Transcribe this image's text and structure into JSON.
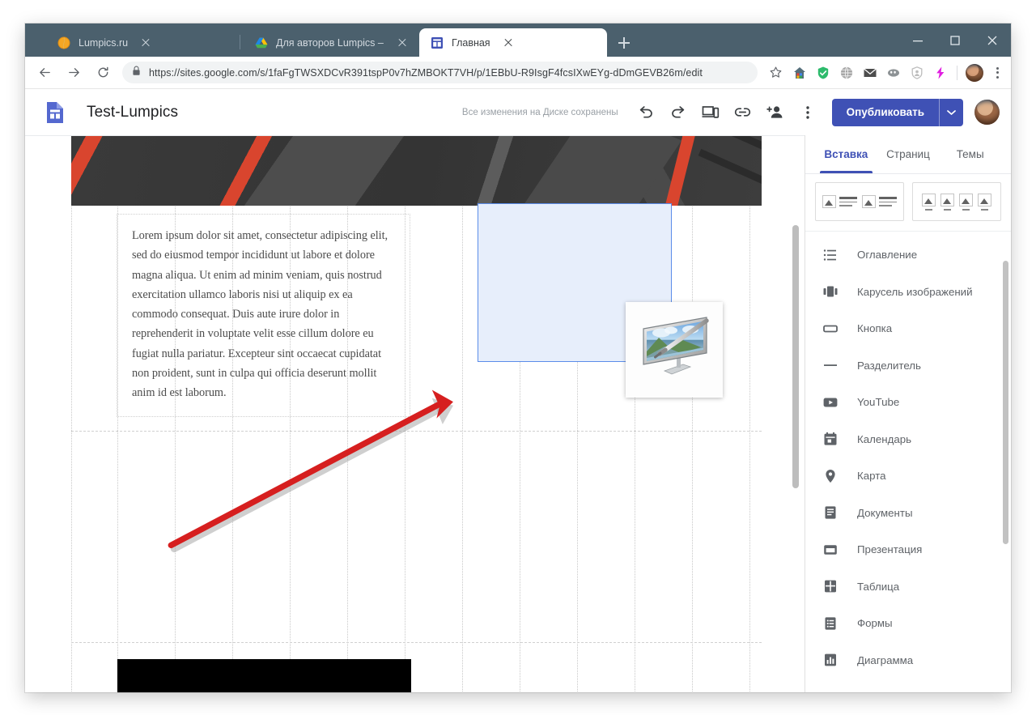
{
  "browser": {
    "tabs": [
      {
        "title": "Lumpics.ru",
        "favicon": "orange-circle-favicon",
        "active": false
      },
      {
        "title": "Для авторов Lumpics – Google /",
        "favicon": "google-drive-favicon",
        "active": false
      },
      {
        "title": "Главная",
        "favicon": "google-sites-favicon",
        "active": true
      }
    ],
    "new_tab_label": "+",
    "window_controls": {
      "minimize": "–",
      "maximize": "□",
      "close": "✕"
    },
    "nav": {
      "back": "←",
      "forward": "→",
      "reload": "⟳"
    },
    "omnibox": {
      "scheme": "https://",
      "host": "sites.google.com",
      "path": "/s/1faFgTWSXDCvR391tspP0v7hZMBOKT7VH/p/1EBbU-R9IsgF4fcsIXwEYg-dDmGEVB26m/edit",
      "full_url": "https://sites.google.com/s/1faFgTWSXDCvR391tspP0v7hZMBOKT7VH/p/1EBbU-R9IsgF4fcsIXwEYg-dDmGEVB26m/edit",
      "lock": "secure-lock-icon"
    },
    "extensions": [
      "bookmark-star-icon",
      "home-colored-icon",
      "adblock-shield-icon",
      "globe-icon",
      "mail-icon",
      "ghost-icon",
      "privacy-shield-icon",
      "lightning-icon"
    ],
    "profile": "profile-avatar",
    "menu": "chrome-kebab-menu"
  },
  "sites": {
    "logo": "google-sites-logo",
    "title": "Test-Lumpics",
    "save_status": "Все изменения на Диске сохранены",
    "actions": [
      {
        "name": "undo",
        "icon": "undo-icon"
      },
      {
        "name": "redo",
        "icon": "redo-icon"
      },
      {
        "name": "preview",
        "icon": "preview-devices-icon"
      },
      {
        "name": "copy-link",
        "icon": "link-icon"
      },
      {
        "name": "add-editors",
        "icon": "add-person-icon"
      },
      {
        "name": "more",
        "icon": "kebab-menu-icon"
      }
    ],
    "publish_label": "Опубликовать",
    "publish_caret": "▼",
    "account_avatar": "account-avatar"
  },
  "canvas": {
    "banner_alt": "dark abstract banner image",
    "text_block": "Lorem ipsum dolor sit amet, consectetur adipiscing elit, sed do eiusmod tempor incididunt ut labore et dolore magna aliqua. Ut enim ad minim veniam, quis nostrud exercitation ullamco laboris nisi ut aliquip ex ea commodo consequat. Duis aute irure dolor in reprehenderit in voluptate velit esse cillum dolore eu fugiat nulla pariatur. Excepteur sint occaecat cupidatat non proident, sunt in culpa qui officia deserunt mollit anim id est laborum.",
    "drop_zone_label": "",
    "floating_image_alt": "monitor-with-stylus-personalization-icon",
    "bottom_image_alt": "black keyboard image",
    "annotation": "red-arrow-pointing-to-drop-zone"
  },
  "panel": {
    "tabs": [
      {
        "label": "Вставка",
        "active": true
      },
      {
        "label": "Страниц",
        "active": false
      },
      {
        "label": "Темы",
        "active": false
      }
    ],
    "layouts": [
      {
        "name": "layout-two-image-text"
      },
      {
        "name": "layout-four-image-caption"
      }
    ],
    "items": [
      {
        "label": "Оглавление",
        "icon": "table-of-contents-icon"
      },
      {
        "label": "Карусель изображений",
        "icon": "image-carousel-icon"
      },
      {
        "label": "Кнопка",
        "icon": "button-icon"
      },
      {
        "label": "Разделитель",
        "icon": "divider-icon"
      },
      {
        "label": "YouTube",
        "icon": "youtube-icon"
      },
      {
        "label": "Календарь",
        "icon": "calendar-icon"
      },
      {
        "label": "Карта",
        "icon": "map-pin-icon"
      },
      {
        "label": "Документы",
        "icon": "google-docs-icon"
      },
      {
        "label": "Презентация",
        "icon": "google-slides-icon"
      },
      {
        "label": "Таблица",
        "icon": "google-sheets-icon"
      },
      {
        "label": "Формы",
        "icon": "google-forms-icon"
      },
      {
        "label": "Диаграмма",
        "icon": "chart-icon"
      }
    ]
  },
  "colors": {
    "accent": "#3f51b5",
    "titlebar": "#4b606d",
    "selection_fill": "#e7eefb",
    "selection_border": "#5b8dea",
    "annotation_red": "#d61f1f"
  }
}
